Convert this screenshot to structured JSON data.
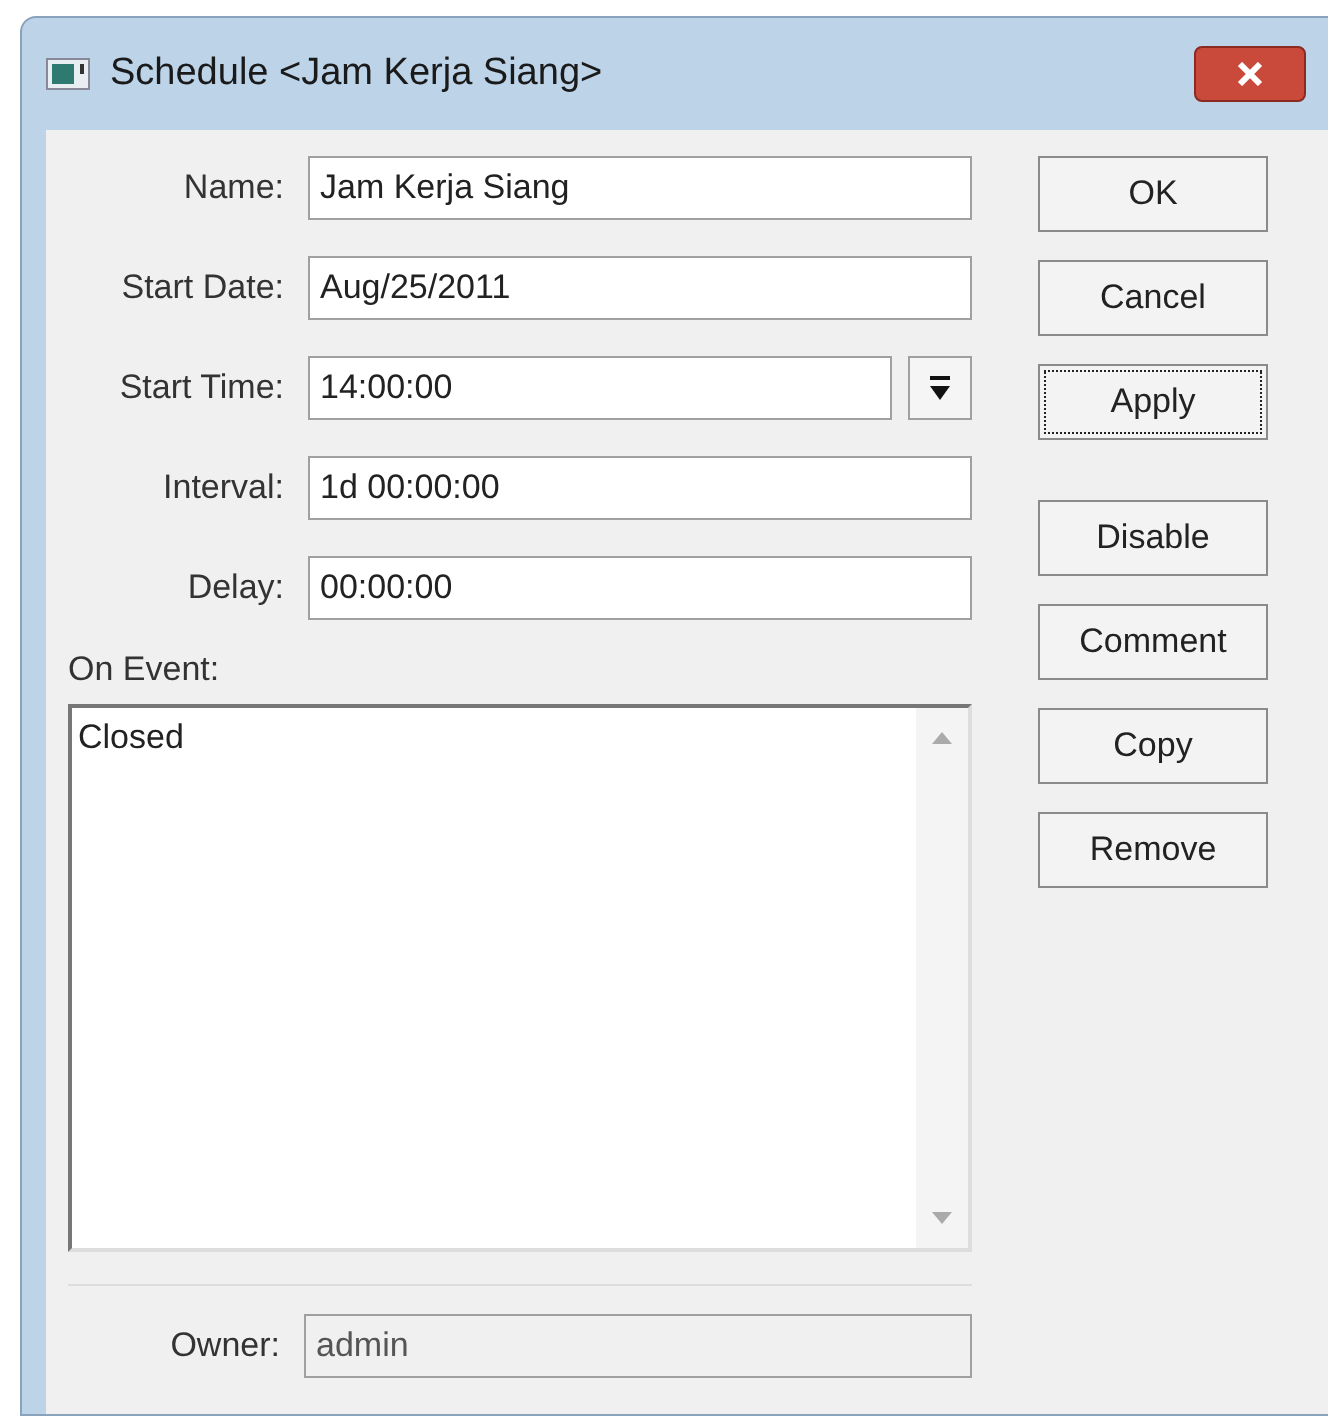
{
  "window": {
    "title": "Schedule <Jam Kerja Siang>"
  },
  "fields": [
    {
      "label": "Name:",
      "value": "Jam Kerja Siang",
      "kind": "text",
      "disabled": false
    },
    {
      "label": "Start Date:",
      "value": "Aug/25/2011",
      "kind": "text",
      "disabled": false
    },
    {
      "label": "Start Time:",
      "value": "14:00:00",
      "kind": "dropdown",
      "disabled": false
    },
    {
      "label": "Interval:",
      "value": "1d 00:00:00",
      "kind": "text",
      "disabled": false
    },
    {
      "label": "Delay:",
      "value": "00:00:00",
      "kind": "text",
      "disabled": false
    }
  ],
  "on_event": {
    "label": "On Event:",
    "value": "Closed"
  },
  "owner": {
    "label": "Owner:",
    "value": "admin",
    "disabled": true
  },
  "button_groups": [
    [
      {
        "label": "OK",
        "focused": false
      },
      {
        "label": "Cancel",
        "focused": false
      },
      {
        "label": "Apply",
        "focused": true
      }
    ],
    [
      {
        "label": "Disable",
        "focused": false
      },
      {
        "label": "Comment",
        "focused": false
      },
      {
        "label": "Copy",
        "focused": false
      },
      {
        "label": "Remove",
        "focused": false
      }
    ]
  ]
}
